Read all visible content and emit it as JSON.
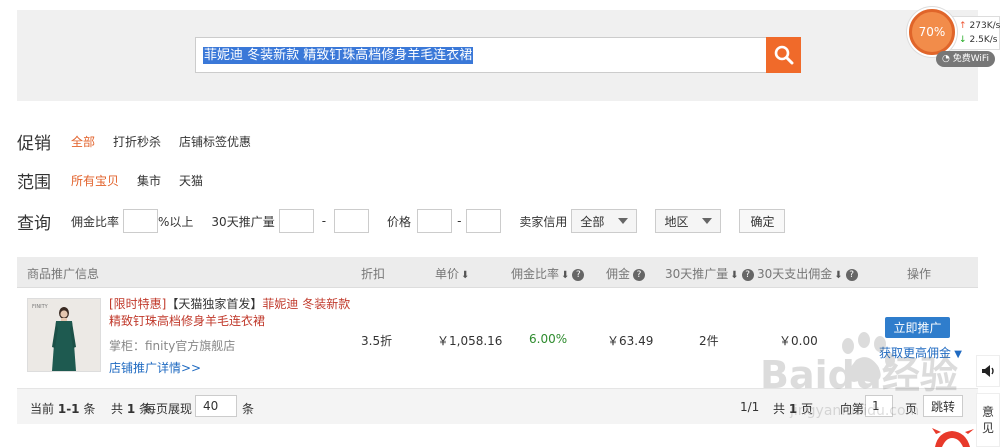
{
  "search": {
    "query": "菲妮迪 冬装新款 精致钉珠高档修身羊毛连衣裙"
  },
  "speed_widget": {
    "percent": "70%",
    "upload": "273K/s",
    "download": "2.5K/s",
    "wifi": "免费WiFi"
  },
  "filters": {
    "promo": {
      "label": "促销",
      "options": [
        "全部",
        "打折秒杀",
        "店铺标签优惠"
      ],
      "active": 0
    },
    "scope": {
      "label": "范围",
      "options": [
        "所有宝贝",
        "集市",
        "天猫"
      ],
      "active": 0
    },
    "query": {
      "label": "查询",
      "commission_rate": "佣金比率",
      "above": "%以上",
      "promo_volume": "30天推广量",
      "dash": "-",
      "price": "价格",
      "seller_credit": "卖家信用",
      "credit_value": "全部",
      "region": "地区",
      "confirm": "确定"
    }
  },
  "table": {
    "headers": {
      "info": "商品推广信息",
      "discount": "折扣",
      "unit_price": "单价",
      "commission_rate": "佣金比率",
      "commission": "佣金",
      "promo_30": "30天推广量",
      "payout_30": "30天支出佣金",
      "action": "操作"
    },
    "rows": [
      {
        "tag1": "[限时特惠]",
        "tag2": "【天猫独家首发】",
        "title": "菲妮迪 冬装新款 精致钉珠高档修身羊毛连衣裙",
        "shopkeeper": "掌柜：finity官方旗舰店",
        "promo_link": "店铺推广详情>>",
        "thumb_brand": "FINITY",
        "discount": "3.5折",
        "unit_price": "￥1,058.16",
        "commission_rate": "6.00%",
        "commission": "￥63.49",
        "promo_30": "2件",
        "payout_30": "￥0.00",
        "promote_btn": "立即推广",
        "more_commission": "获取更高佣金"
      }
    ]
  },
  "pager": {
    "current_prefix": "当前",
    "current_range": "1-1",
    "item_unit": "条",
    "total_prefix": "共",
    "total": "1",
    "per_page_label": "每页展现",
    "per_page": "40",
    "page_status": "1/1",
    "total_pages_prefix": "共",
    "total_pages": "1",
    "page_unit": "页",
    "goto_prefix": "向第",
    "goto_value": "1",
    "goto_suffix": "页",
    "jump": "跳转"
  },
  "side": {
    "feedback": "意见"
  },
  "watermark": {
    "text": "Baidu经验",
    "url": "jingyan.baidu.com"
  },
  "colors": {
    "accent_orange": "#e2622b",
    "search_button": "#f06a2a",
    "link_blue": "#1f6ac1",
    "button_blue": "#2f7dcc",
    "title_red": "#c0392b",
    "rate_green": "#2e8b2e"
  }
}
